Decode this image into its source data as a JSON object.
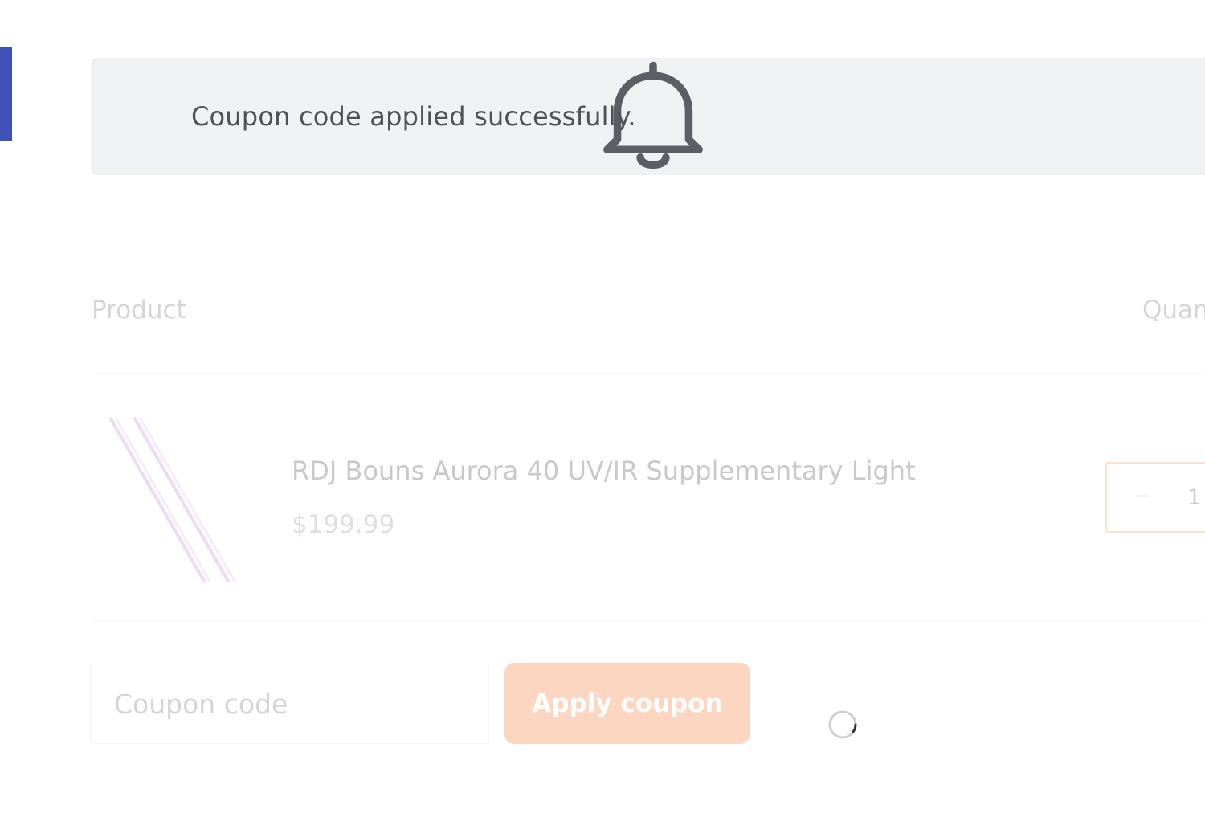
{
  "notice": {
    "icon": "bell-icon",
    "message": "Coupon code applied successfully."
  },
  "cart": {
    "columns": {
      "product": "Product",
      "quantity": "Quan"
    },
    "items": [
      {
        "name": "RDJ Bouns Aurora 40 UV/IR Supplementary Light",
        "price": "$199.99",
        "quantity": "1",
        "decrement_icon": "minus-icon"
      }
    ]
  },
  "coupon": {
    "placeholder": "Coupon code",
    "apply_label": "Apply coupon"
  },
  "loading": {
    "icon": "loading-spinner-icon"
  },
  "colors": {
    "accent_bar": "#3f51b5",
    "primary_button": "#f97f3e",
    "notice_background": "#f0f1f3"
  }
}
